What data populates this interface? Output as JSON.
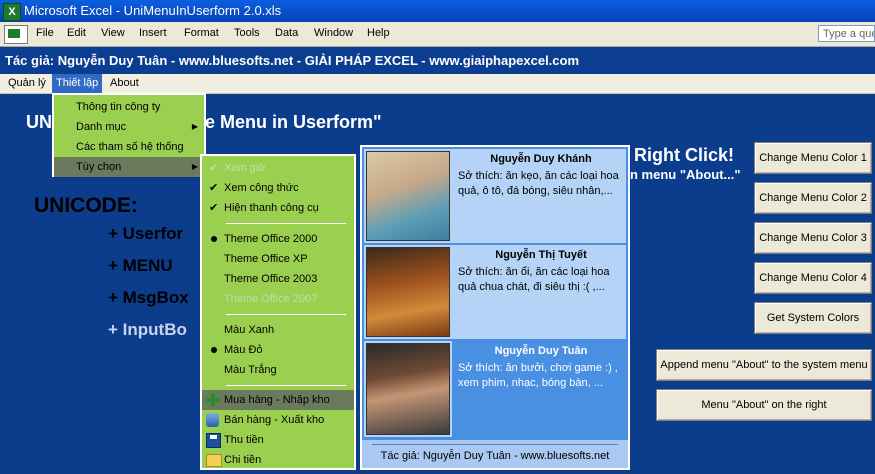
{
  "window": {
    "title": "Microsoft Excel - UniMenuInUserform 2.0.xls",
    "app_icon": "X"
  },
  "menubar": {
    "items": [
      "File",
      "Edit",
      "View",
      "Insert",
      "Format",
      "Tools",
      "Data",
      "Window",
      "Help"
    ],
    "help_placeholder": "Type a que"
  },
  "author_bar": "Tác giả: Nguyễn Duy Tuân - www.bluesofts.net - GIẢI PHÁP EXCEL - www.giaiphapexcel.com",
  "userform_menu": {
    "items": [
      "Quản lý",
      "Thiết lập",
      "About"
    ],
    "active_index": 1
  },
  "form": {
    "heading_left": "UN",
    "heading_right": "e Menu in Userform\"",
    "right_click_title": "Right Click!",
    "right_click_sub": "n menu \"About...\"",
    "unicode_label": "UNICODE:",
    "list": [
      "+ Userfor",
      "+ MENU",
      "+ MsgBox",
      "+ InputBo"
    ],
    "buttons": [
      "Change Menu Color 1",
      "Change Menu Color 2",
      "Change Menu Color 3",
      "Change Menu Color 4",
      "Get System Colors",
      "Append menu \"About\" to the system menu",
      "Menu \"About\" on the right"
    ]
  },
  "menu_level1": {
    "items": [
      "Thông tin công ty",
      "Danh mục",
      "Các tham số hệ thống",
      "Tùy chọn"
    ],
    "submenu_arrow": "▶",
    "selected_index": 3
  },
  "menu_level2": {
    "items": [
      {
        "label": "Xem giờ",
        "state": "check-disabled"
      },
      {
        "label": "Xem công thức",
        "state": "check"
      },
      {
        "label": "Hiện thanh công cụ",
        "state": "check"
      },
      {
        "label": "Theme Office 2000",
        "state": "radio"
      },
      {
        "label": "Theme Office XP",
        "state": "none"
      },
      {
        "label": "Theme Office 2003",
        "state": "none"
      },
      {
        "label": "Theme Office 2007",
        "state": "disabled"
      },
      {
        "label": "Màu Xanh",
        "state": "none"
      },
      {
        "label": "Màu Đỏ",
        "state": "radio"
      },
      {
        "label": "Màu Trắng",
        "state": "none"
      },
      {
        "label": "Mua hàng - Nhập kho",
        "state": "icon-plus"
      },
      {
        "label": "Bán hàng - Xuất kho",
        "state": "icon-db"
      },
      {
        "label": "Thu tiền",
        "state": "icon-save"
      },
      {
        "label": "Chi tiền",
        "state": "icon-folder"
      }
    ],
    "check_glyph": "✔",
    "selected_index": 10
  },
  "people": {
    "cards": [
      {
        "name": "Nguyễn Duy Khánh",
        "hobby": "Sở thích: ăn kẹo, ăn các loại hoa quả, ô tô, đá bóng, siêu nhân,..."
      },
      {
        "name": "Nguyễn Thị Tuyết",
        "hobby": "Sở thích: ăn ổi, ăn các loại hoa quả chua chát, đi siêu thị :( ,..."
      },
      {
        "name": "Nguyễn Duy Tuân",
        "hobby": "Sở thích: ăn bưởi, chơi game :) , xem phim, nhạc, bóng bàn, ..."
      }
    ],
    "footer": "Tác giả: Nguyễn Duy Tuân - www.bluesofts.net"
  },
  "colors": {
    "menu_green": "#9bcf50",
    "form_blue": "#0b3d8c",
    "card_light": "#b4d3f7",
    "card_sel": "#4a90e2"
  }
}
